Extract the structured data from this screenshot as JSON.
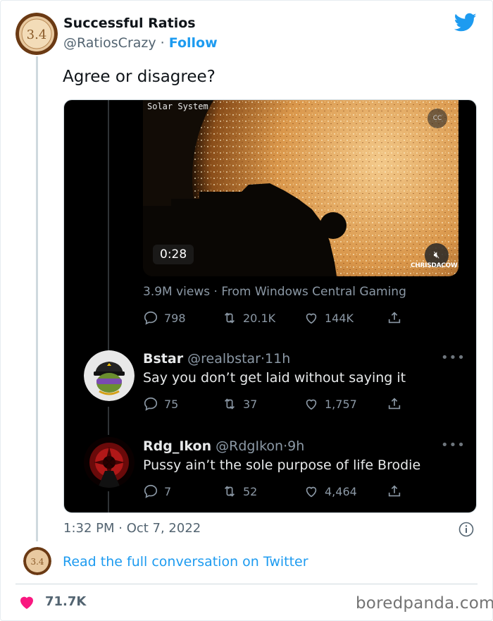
{
  "author": {
    "display_name": "Successful Ratios",
    "handle": "@RatiosCrazy",
    "separator": "·",
    "follow_label": "Follow",
    "avatar_text": "3.4"
  },
  "tweet": {
    "text": "Agree or disagree?",
    "timestamp": "1:32 PM · Oct 7, 2022",
    "read_more_label": "Read the full conversation on Twitter",
    "likes": "71.7K"
  },
  "embedded": {
    "video": {
      "title": "Solar System",
      "duration": "0:28",
      "watermark": "CHRISDACOW",
      "cc_label": "CC"
    },
    "views_line": "3.9M views · From Windows Central Gaming",
    "main_actions": {
      "replies": "798",
      "retweets": "20.1K",
      "likes": "144K"
    },
    "replies": [
      {
        "name": "Bstar",
        "handle": "@realbstar",
        "time": "11h",
        "text": "Say you don’t get laid without saying it",
        "replies": "75",
        "retweets": "37",
        "likes": "1,757"
      },
      {
        "name": "Rdg_Ikon",
        "handle": "@RdgIkon",
        "time": "9h",
        "text": "Pussy ain’t the sole purpose of life Brodie",
        "replies": "7",
        "retweets": "52",
        "likes": "4,464"
      }
    ]
  },
  "footer": {
    "brand": "boredpanda.com"
  },
  "colors": {
    "twitter_blue": "#1d9bf0",
    "heart_red": "#f91880",
    "dark_bg": "#000000",
    "muted_gray": "#536471"
  },
  "icons": [
    "twitter-bird-icon",
    "reply-icon",
    "retweet-icon",
    "like-icon",
    "share-icon",
    "info-icon",
    "heart-icon",
    "mute-icon",
    "captions-icon"
  ]
}
